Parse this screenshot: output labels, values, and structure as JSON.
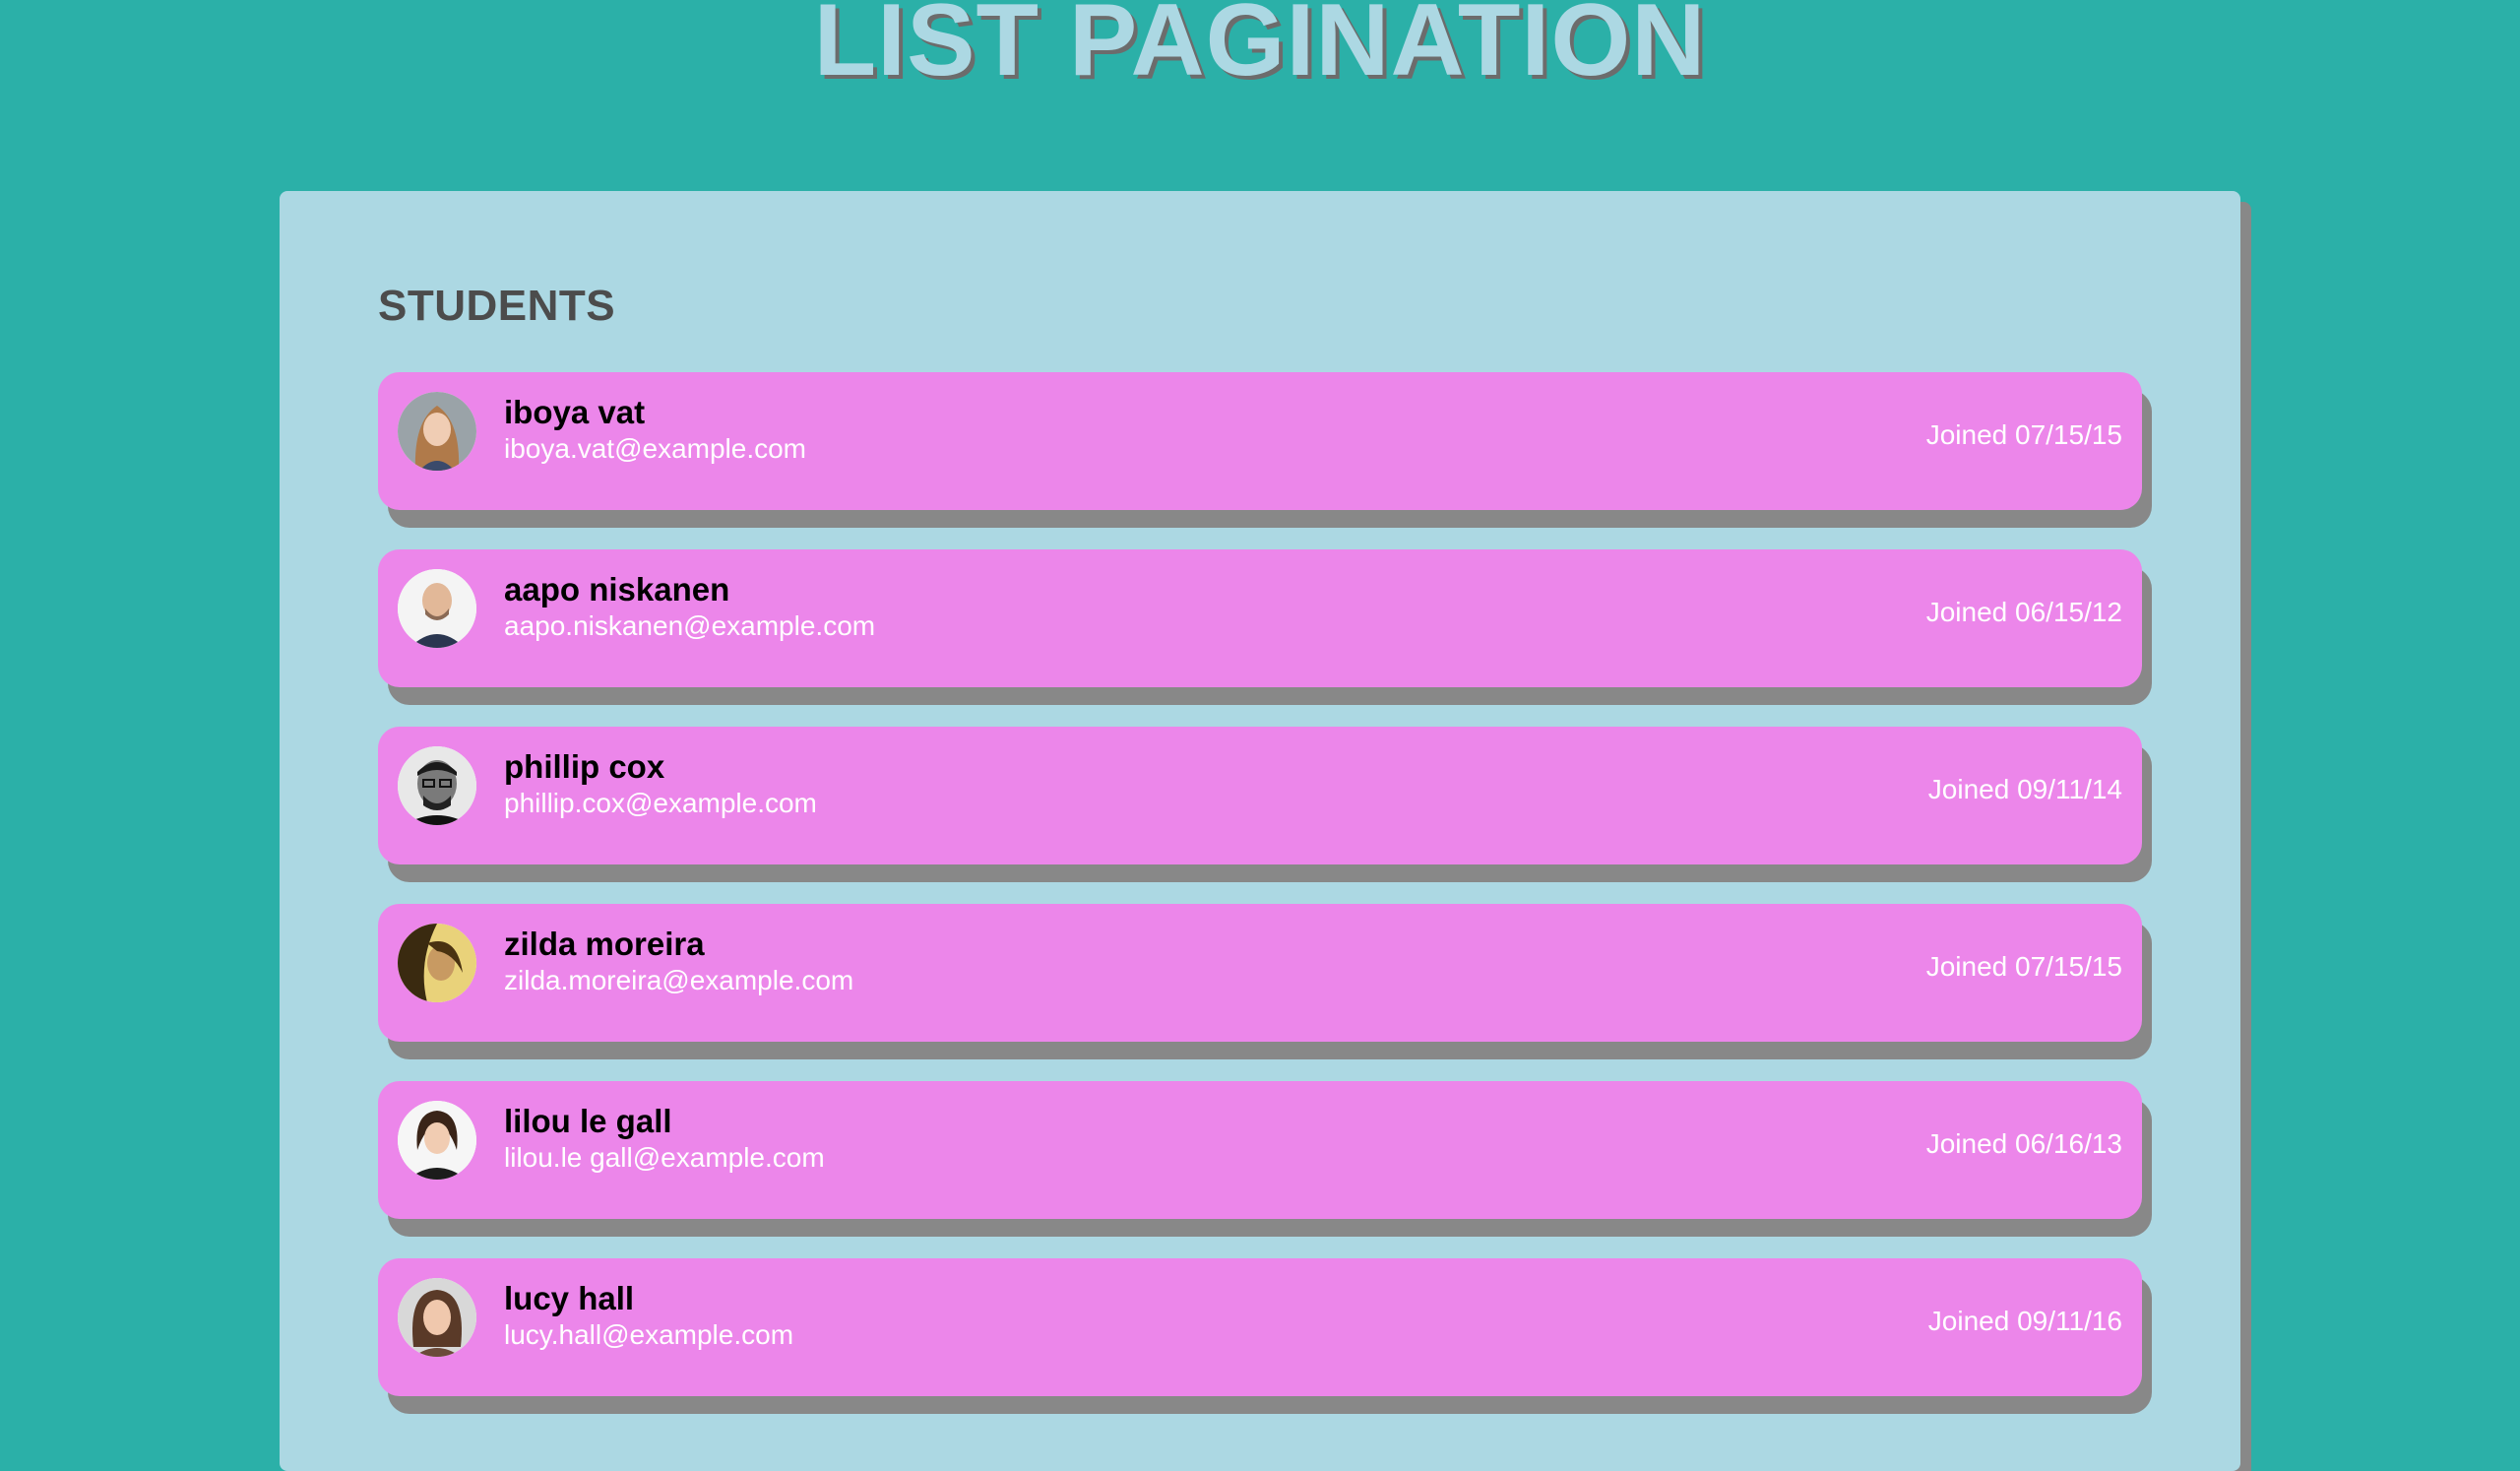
{
  "page": {
    "title": "LIST PAGINATION"
  },
  "panel": {
    "heading": "STUDENTS"
  },
  "students": [
    {
      "name": "iboya vat",
      "email": "iboya.vat@example.com",
      "joined": "Joined 07/15/15"
    },
    {
      "name": "aapo niskanen",
      "email": "aapo.niskanen@example.com",
      "joined": "Joined 06/15/12"
    },
    {
      "name": "phillip cox",
      "email": "phillip.cox@example.com",
      "joined": "Joined 09/11/14"
    },
    {
      "name": "zilda moreira",
      "email": "zilda.moreira@example.com",
      "joined": "Joined 07/15/15"
    },
    {
      "name": "lilou le gall",
      "email": "lilou.le gall@example.com",
      "joined": "Joined 06/16/13"
    },
    {
      "name": "lucy hall",
      "email": "lucy.hall@example.com",
      "joined": "Joined 09/11/16"
    }
  ],
  "colors": {
    "background": "#2bb0a8",
    "panel": "#acd8e3",
    "card": "#ec86ea",
    "shadow": "#888888",
    "title": "#acd8e3"
  }
}
